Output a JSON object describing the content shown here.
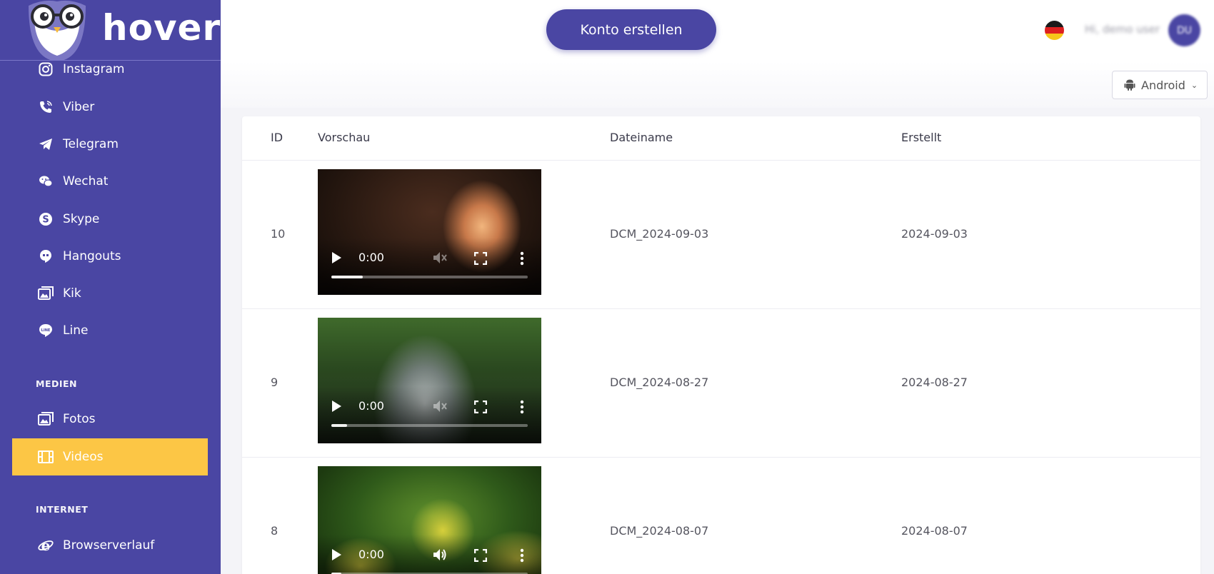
{
  "brand": {
    "name": "hoverwatch"
  },
  "sidebar": {
    "items": [
      {
        "label": "Instagram",
        "icon": "instagram-icon"
      },
      {
        "label": "Viber",
        "icon": "phone-icon"
      },
      {
        "label": "Telegram",
        "icon": "telegram-icon"
      },
      {
        "label": "Wechat",
        "icon": "wechat-icon"
      },
      {
        "label": "Skype",
        "icon": "skype-icon"
      },
      {
        "label": "Hangouts",
        "icon": "hangouts-icon"
      },
      {
        "label": "Kik",
        "icon": "image-gallery-icon"
      },
      {
        "label": "Line",
        "icon": "line-icon"
      }
    ],
    "media_section": "MEDIEN",
    "media_items": [
      {
        "label": "Fotos",
        "icon": "image-gallery-icon"
      },
      {
        "label": "Videos",
        "icon": "film-icon",
        "active": true
      }
    ],
    "internet_section": "INTERNET",
    "internet_items": [
      {
        "label": "Browserverlauf",
        "icon": "internet-explorer-icon"
      }
    ]
  },
  "header": {
    "cta_label": "Konto erstellen",
    "language_flag": "germany-flag-icon",
    "greeting": "Hi, demo user",
    "avatar_initials": "DU"
  },
  "toolbar": {
    "platform": "Android",
    "platform_icon": "android-icon"
  },
  "table": {
    "columns": [
      "ID",
      "Vorschau",
      "Dateiname",
      "Erstellt"
    ],
    "rows": [
      {
        "id": "10",
        "filename": "DCM_2024-09-03",
        "created": "2024-09-03",
        "time": "0:00",
        "progress": 0.16,
        "muted": true
      },
      {
        "id": "9",
        "filename": "DCM_2024-08-27",
        "created": "2024-08-27",
        "time": "0:00",
        "progress": 0.08,
        "muted": true
      },
      {
        "id": "8",
        "filename": "DCM_2024-08-07",
        "created": "2024-08-07",
        "time": "0:00",
        "progress": 0.05,
        "muted": false
      }
    ]
  },
  "colors": {
    "primary": "#4a46a3",
    "active": "#fcc645",
    "background": "#f4f4f8"
  }
}
